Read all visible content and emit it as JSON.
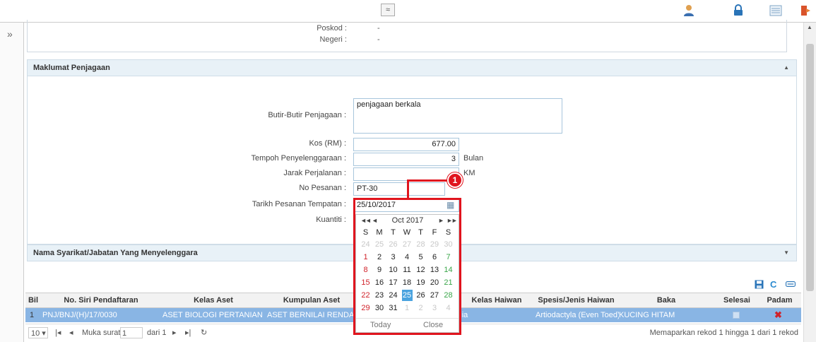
{
  "toolbar": {
    "collapse_glyph": "≈"
  },
  "rail": {
    "expand_glyph": "»"
  },
  "address": {
    "poskod_label": "Poskod :",
    "poskod_value": "-",
    "negeri_label": "Negeri :",
    "negeri_value": "-"
  },
  "maklumat": {
    "title": "Maklumat Penjagaan",
    "butir_label": "Butir-Butir Penjagaan :",
    "butir_value": "penjagaan berkala",
    "kos_label": "Kos (RM) :",
    "kos_value": "677.00",
    "tempoh_label": "Tempoh Penyelenggaraan :",
    "tempoh_value": "3",
    "tempoh_unit": "Bulan",
    "jarak_label": "Jarak Perjalanan :",
    "jarak_value": "",
    "jarak_unit": "KM",
    "pesanan_label": "No Pesanan :",
    "pesanan_value": "PT-30",
    "tarikh_label": "Tarikh Pesanan Tempatan :",
    "tarikh_value": "25/10/2017",
    "kuantiti_label": "Kuantiti :"
  },
  "calendar": {
    "month_year": "Oct 2017",
    "prev_year": "◄◄",
    "prev_month": "◄",
    "next_month": "►",
    "next_year": "►►",
    "dow": [
      "S",
      "M",
      "T",
      "W",
      "T",
      "F",
      "S"
    ],
    "weeks": [
      [
        "24",
        "25",
        "26",
        "27",
        "28",
        "29",
        "30"
      ],
      [
        "1",
        "2",
        "3",
        "4",
        "5",
        "6",
        "7"
      ],
      [
        "8",
        "9",
        "10",
        "11",
        "12",
        "13",
        "14"
      ],
      [
        "15",
        "16",
        "17",
        "18",
        "19",
        "20",
        "21"
      ],
      [
        "22",
        "23",
        "24",
        "25",
        "26",
        "27",
        "28"
      ],
      [
        "29",
        "30",
        "31",
        "1",
        "2",
        "3",
        "4"
      ]
    ],
    "selected_day": "25",
    "today_label": "Today",
    "close_label": "Close",
    "colors": {
      "sunday": "#d0222a",
      "saturday": "#3aa64a",
      "selected_bg": "#4aa3df",
      "faded": "#c8c8c8"
    }
  },
  "syarikat": {
    "title": "Nama Syarikat/Jabatan Yang Menyelenggara"
  },
  "table": {
    "headers": [
      "Bil",
      "No. Siri Pendaftaran",
      "Kelas Aset",
      "Kumpulan Aset",
      "Kelas Haiwan",
      "Spesis/Jenis Haiwan",
      "Baka",
      "Selesai",
      "Padam"
    ],
    "row": {
      "bil": "1",
      "no_siri": "PNJ/BNJ/(H)/17/0030",
      "kelas_aset": "ASET BIOLOGI PERTANIAN",
      "kumpulan_aset": "ASET BERNILAI RENDAH",
      "kelas_haiwan": "...alia",
      "spesis": "Artiodactyla (Even Toed)",
      "baka": "KUCING HITAM"
    }
  },
  "pager": {
    "page_size": "10",
    "page_label": "Muka surat",
    "page_value": "1",
    "of_label": "dari 1",
    "summary": "Memaparkan rekod 1 hingga 1 dari 1 rekod"
  },
  "annotation": {
    "callout_number": "1",
    "color": "#e0141e"
  }
}
